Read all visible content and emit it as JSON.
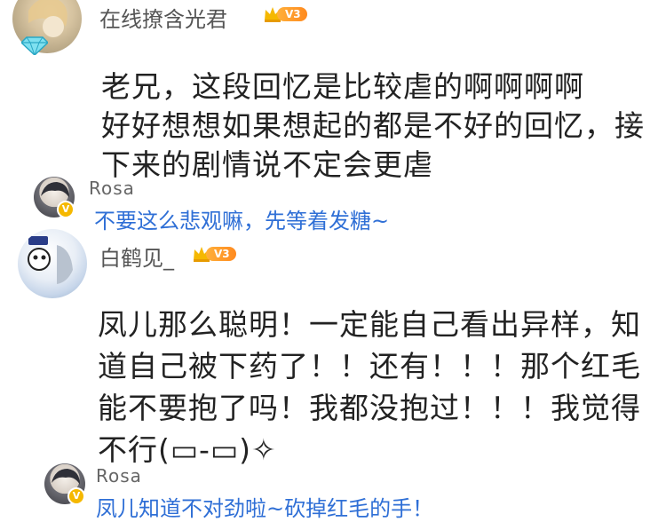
{
  "comments": [
    {
      "username": "在线撩含光君",
      "vip_label": "V3",
      "text_lines": [
        "老兄，这段回忆是比较虐的啊啊啊啊",
        "好好想想如果想起的都是不好的回忆，接",
        "下来的剧情说不定会更虐"
      ],
      "reply": {
        "username": "Rosa",
        "badge": "V",
        "text": "不要这么悲观嘛，先等着发糖~"
      }
    },
    {
      "username": "白鹤见_",
      "vip_label": "V3",
      "text_lines": [
        "凤儿那么聪明！一定能自己看出异样，知",
        "道自己被下药了！！还有！！！那个红毛",
        "能不要抱了吗！我都没抱过！！！我觉得",
        "不行(▭-▭)✧"
      ],
      "reply": {
        "username": "Rosa",
        "badge": "V",
        "text": "凤儿知道不对劲啦~砍掉红毛的手！"
      }
    }
  ],
  "colors": {
    "username": "#555555",
    "comment_text": "#222222",
    "reply_link": "#2f6fd6",
    "vip_gold": "#f5b800",
    "vip_orange": "#ff8a1f"
  },
  "icons": {
    "crown": "crown-icon",
    "gem": "diamond-icon",
    "verified": "verified-v-icon"
  }
}
